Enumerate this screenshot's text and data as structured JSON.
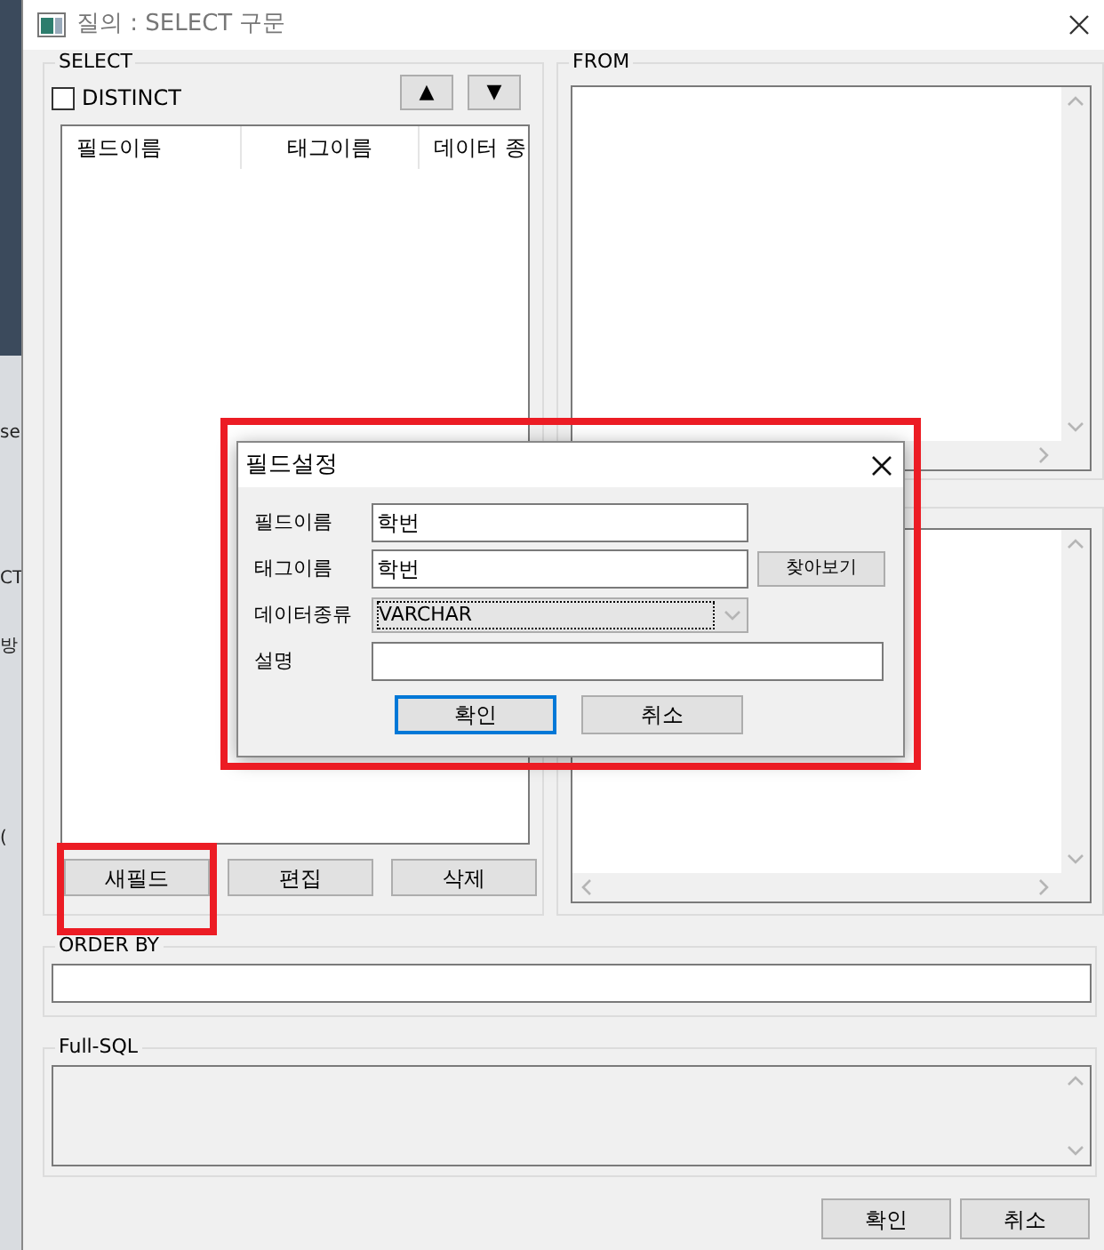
{
  "window": {
    "title": "질의 : SELECT 구문"
  },
  "background_fragments": [
    "se",
    "CT",
    "방",
    "("
  ],
  "select_group": {
    "label": "SELECT",
    "distinct": {
      "label": "DISTINCT",
      "checked": false
    },
    "move_buttons": [
      "▲",
      "▼"
    ],
    "columns": [
      "필드이름",
      "태그이름",
      "데이터 종"
    ],
    "buttons": [
      {
        "label": "새필드",
        "highlighted": true
      },
      {
        "label": "편집",
        "highlighted": false
      },
      {
        "label": "삭제",
        "highlighted": false
      }
    ]
  },
  "from_group": {
    "label": "FROM"
  },
  "order_by": {
    "label": "ORDER BY"
  },
  "full_sql": {
    "label": "Full-SQL"
  },
  "buttons": [
    "확인",
    "취소"
  ],
  "dialog": {
    "title": "필드설정",
    "highlighted": true,
    "fields": [
      {
        "label": "필드이름",
        "kind": "text",
        "value": "학번"
      },
      {
        "label": "태그이름",
        "kind": "browse",
        "value": "학번",
        "button": "찾아보기"
      },
      {
        "label": "데이터종류",
        "kind": "select",
        "value": "VARCHAR"
      },
      {
        "label": "설명",
        "kind": "wide"
      }
    ],
    "buttons": [
      {
        "label": "확인",
        "default": true
      },
      {
        "label": "취소",
        "default": false
      }
    ]
  }
}
